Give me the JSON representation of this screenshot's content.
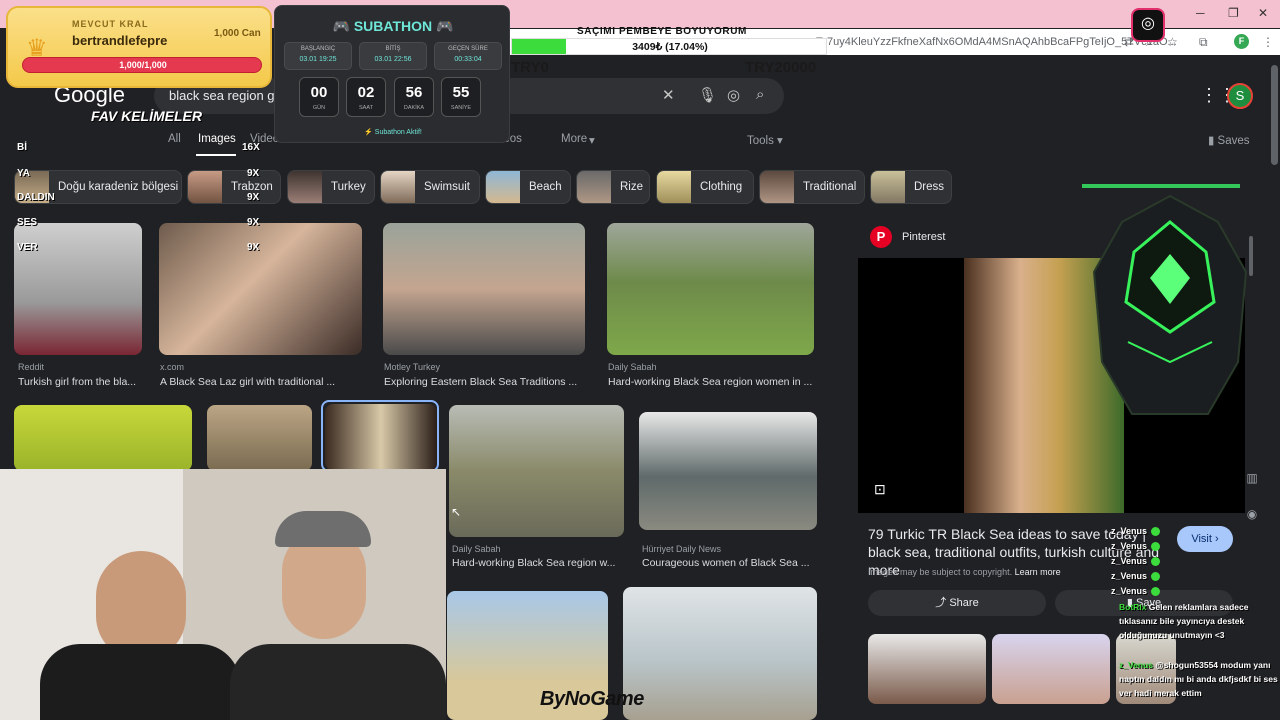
{
  "browser": {
    "url_fragment": "Tc7uy4KleuYzzFkfneXafNx6OMdA4MSnAQAhbBcaFPgTeIjO_5TVc1aO...",
    "profile_initial": "F",
    "min_icon": "minimize-icon",
    "colors": {
      "tab_strip": "#f4c1d0"
    }
  },
  "google": {
    "logo": "Google",
    "query": "black sea region gir",
    "profile_initial": "S",
    "tabs": [
      "All",
      "Images",
      "Videos",
      "Short videos",
      "More"
    ],
    "tools": "Tools",
    "saves": "Saves",
    "chips": [
      "Doğu karadeniz bölgesi",
      "Trabzon",
      "Turkey",
      "Swimsuit",
      "Beach",
      "Rize",
      "Clothing",
      "Traditional",
      "Dress"
    ],
    "results": [
      {
        "source": "Reddit",
        "title": "Turkish girl from the bla..."
      },
      {
        "source": "x.com",
        "title": "A Black Sea Laz girl with traditional ..."
      },
      {
        "source": "Motley Turkey",
        "title": "Exploring Eastern Black Sea Traditions ..."
      },
      {
        "source": "Daily Sabah",
        "title": "Hard-working Black Sea region women in ..."
      },
      {
        "source": "Daily Sabah",
        "title": "Hard-working Black Sea region w..."
      },
      {
        "source": "Hürriyet Daily News",
        "title": "Courageous women of Black Sea ..."
      }
    ],
    "panel": {
      "source": "Pinterest",
      "title": "79 Turkic TR Black Sea ideas to save today | black sea, traditional outfits, turkish culture and more",
      "visit": "Visit",
      "copyright": "Images may be subject to copyright.",
      "learn_more": "Learn more",
      "share": "Share",
      "save": "Save"
    }
  },
  "overlay": {
    "king": {
      "label": "MEVCUT KRAL",
      "name": "bertrandlefepre",
      "can": "1,000 Can",
      "bar": "1,000/1,000"
    },
    "subathon": {
      "title": "SUBATHON",
      "cells": [
        {
          "k": "BAŞLANGIÇ",
          "v": "03.01 19:25"
        },
        {
          "k": "BİTİŞ",
          "v": "03.01 22:56"
        },
        {
          "k": "GEÇEN SÜRE",
          "v": "00:33:04"
        }
      ],
      "counts": [
        {
          "v": "00",
          "k": "GÜN"
        },
        {
          "v": "02",
          "k": "SAAT"
        },
        {
          "v": "56",
          "k": "DAKİKA"
        },
        {
          "v": "55",
          "k": "SANİYE"
        }
      ],
      "status": "Subathon Aktif!"
    },
    "goal": {
      "title": "SAÇIMI PEMBEYE BOYUYORUM",
      "progress_text": "3409₺ (17.04%)",
      "progress": 0.1704,
      "left_label": "TRY0",
      "right_label": "TRY20000"
    },
    "fav": {
      "title": "FAV KELİMELER",
      "items": [
        "Bİ",
        "16X",
        "YA",
        "9X",
        "DALDIN",
        "9X",
        "SES",
        "9X",
        "VER",
        "9X"
      ]
    },
    "brand": "ByNoGame",
    "chat": {
      "users": [
        "z_Venus",
        "z_Venus",
        "z_Venus",
        "z_Venus",
        "z_Venus"
      ],
      "bot_nick": "BotRix",
      "bot_msg": "Gelen reklamlara sadece tıklasanız bile yayıncıya destek olduğunuzu unutmayın <3",
      "user_nick": "z_Venus",
      "user_msg": "@shogun53554 modum yanı naptın daldın mı bi anda dkfjsdkf bi ses ver hadi merak ettim"
    }
  }
}
